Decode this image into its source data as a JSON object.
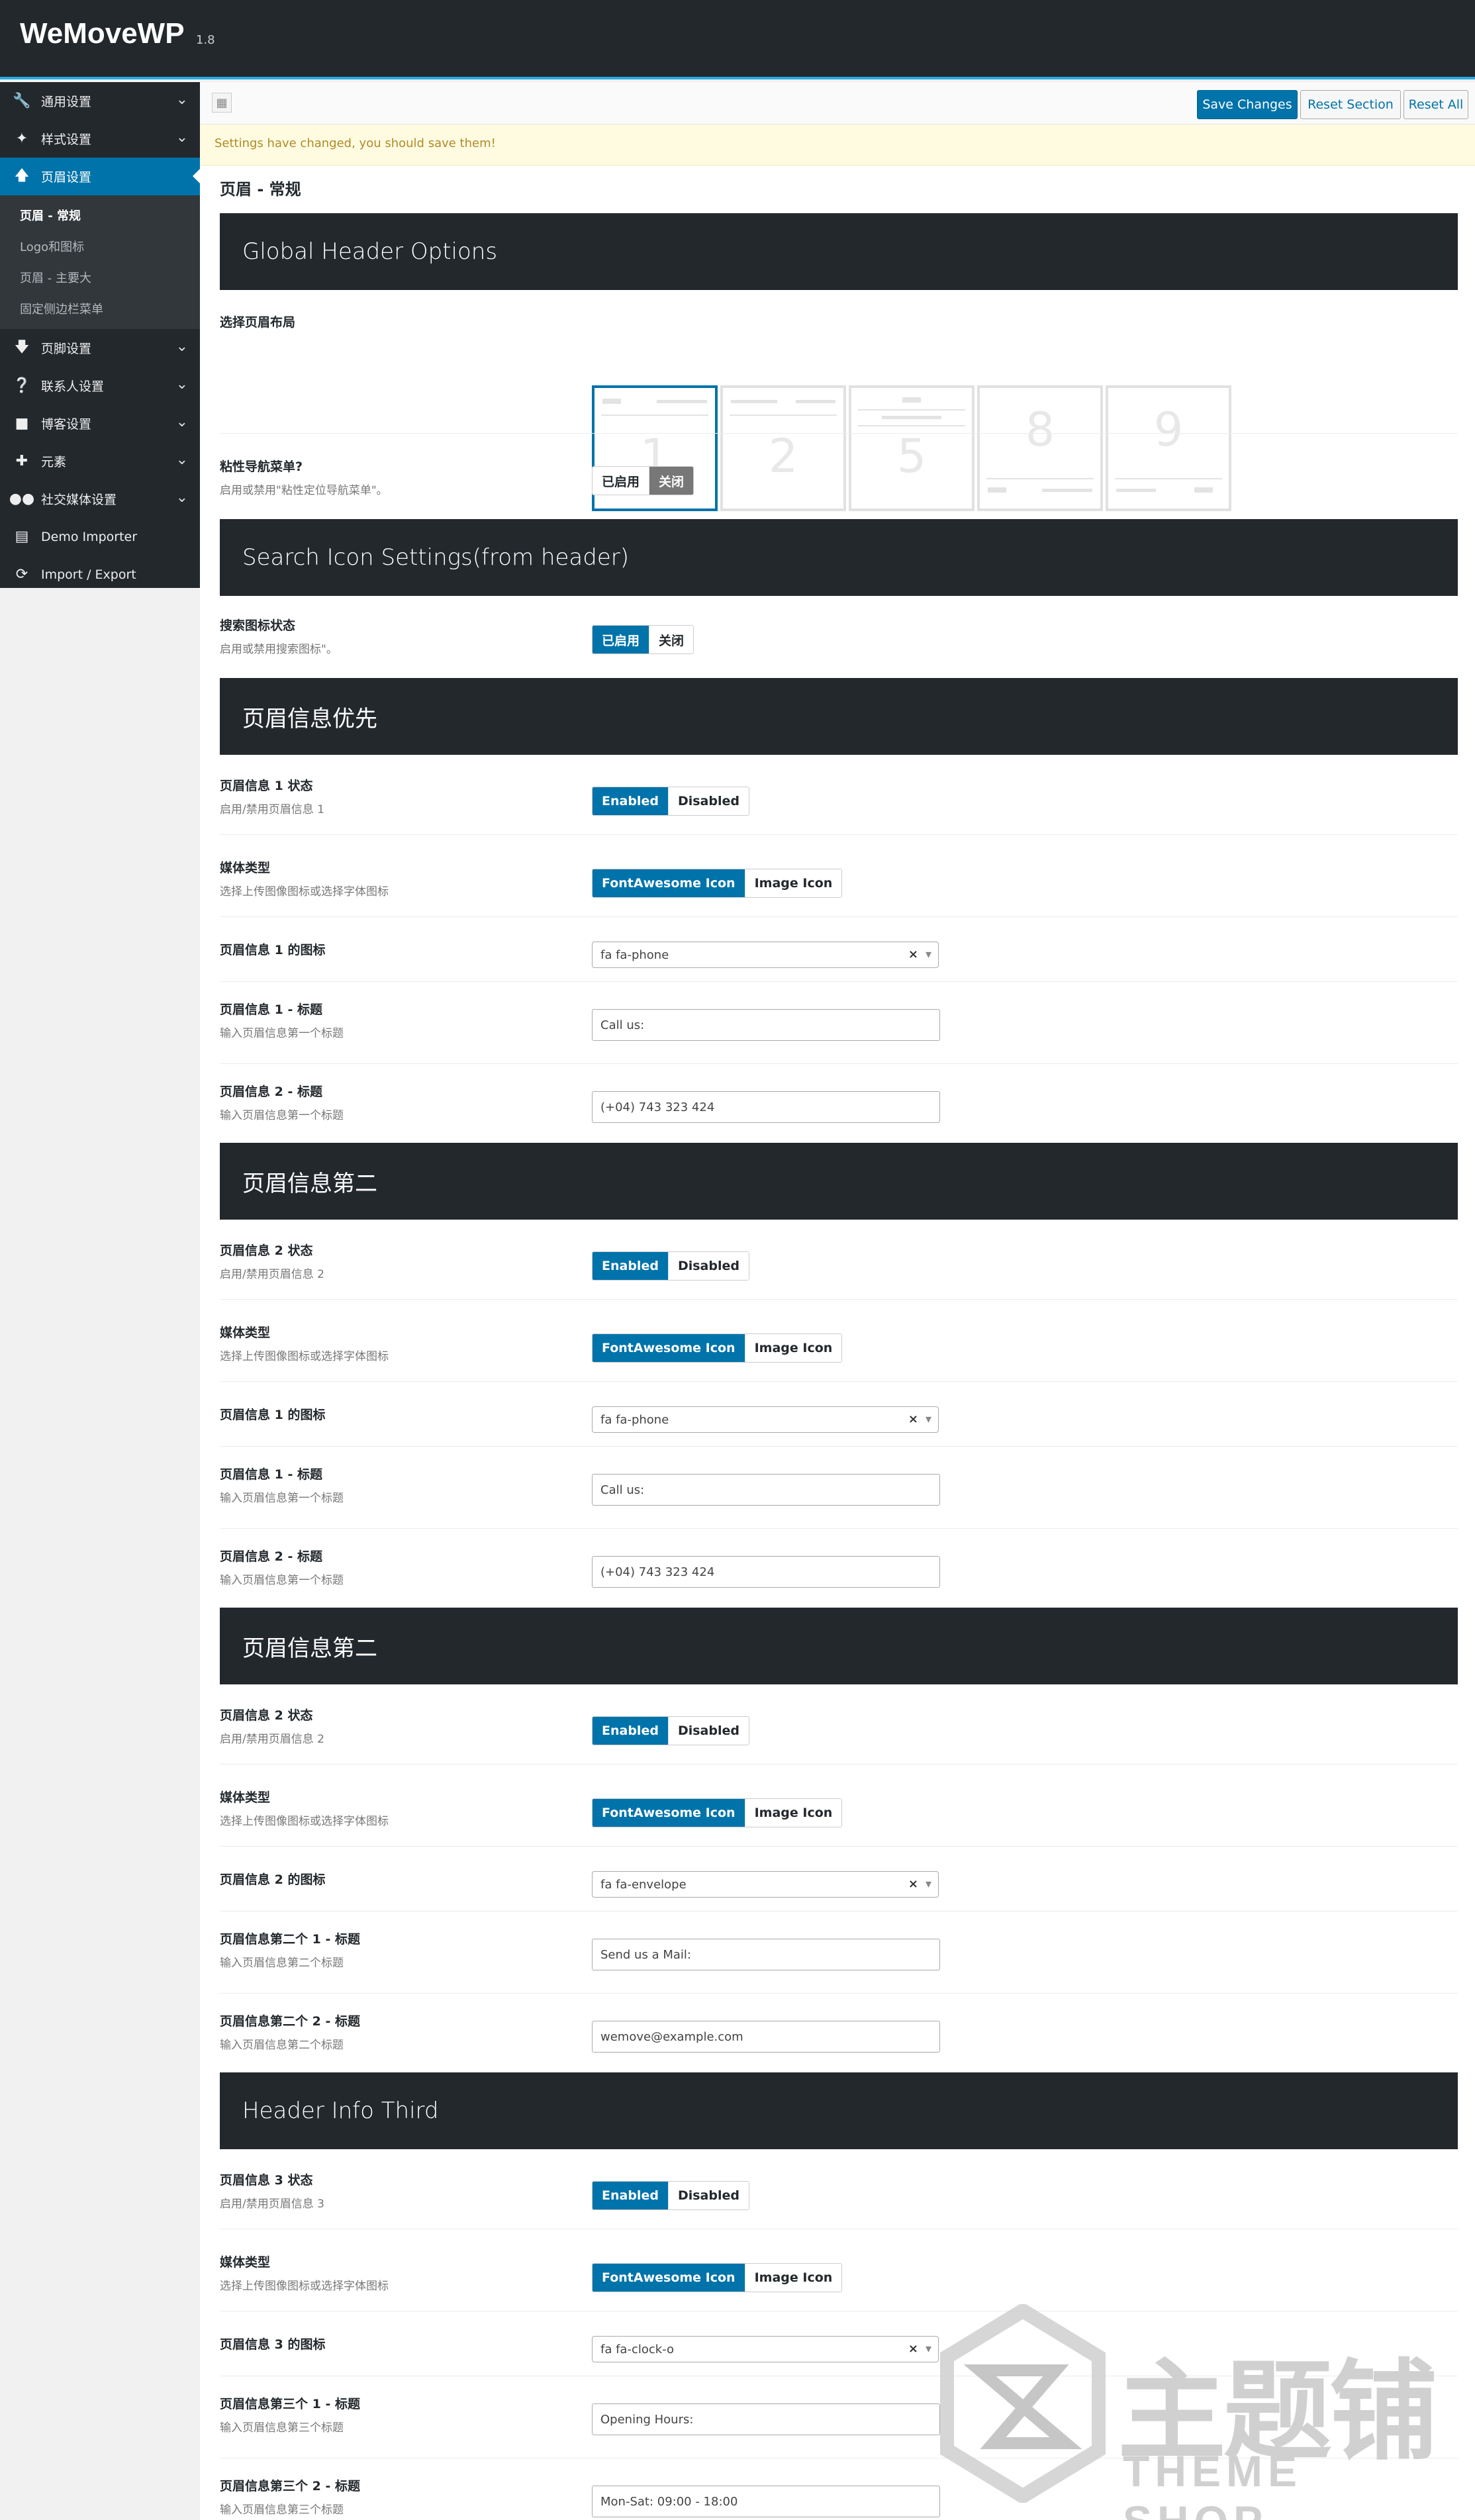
{
  "app": {
    "name": "WeMoveWP",
    "version": "1.8"
  },
  "sidebar": {
    "items": [
      {
        "label": "通用设置",
        "icon": "wrench-icon"
      },
      {
        "label": "样式设置",
        "icon": "magic-wand-icon"
      },
      {
        "label": "页眉设置",
        "icon": "arrow-up-icon",
        "active": true
      },
      {
        "label": "页脚设置",
        "icon": "arrow-down-icon"
      },
      {
        "label": "联系人设置",
        "icon": "question-circle-icon"
      },
      {
        "label": "博客设置",
        "icon": "comment-icon"
      },
      {
        "label": "元素",
        "icon": "puzzle-icon"
      },
      {
        "label": "社交媒体设置",
        "icon": "users-icon"
      },
      {
        "label": "Demo Importer",
        "icon": "list-icon"
      },
      {
        "label": "Import / Export",
        "icon": "refresh-icon"
      }
    ],
    "submenu": [
      "页眉 - 常规",
      "Logo和图标",
      "页眉 - 主要大",
      "固定侧边栏菜单"
    ]
  },
  "toolbar": {
    "save": "Save Changes",
    "reset_section": "Reset Section",
    "reset_all": "Reset All"
  },
  "notice": "Settings have changed, you should save them!",
  "section_title": "页眉 - 常规",
  "headers": {
    "global": "Global Header Options",
    "search": "Search Icon Settings(from header)",
    "info1": "页眉信息优先",
    "info2a": "页眉信息第二",
    "info2b": "页眉信息第二",
    "info3": "Header Info Third"
  },
  "layout": {
    "label": "选择页眉布局",
    "options": [
      "1",
      "2",
      "5",
      "8",
      "9"
    ],
    "selected": "1"
  },
  "sticky": {
    "label": "粘性导航菜单?",
    "desc": "启用或禁用\"粘性定位导航菜单\"。",
    "on": "已启用",
    "off": "关闭",
    "value": "off"
  },
  "search_icon": {
    "label": "搜索图标状态",
    "desc": "启用或禁用搜索图标\"。",
    "on": "已启用",
    "off": "关闭",
    "value": "on"
  },
  "common": {
    "enabled": "Enabled",
    "disabled": "Disabled",
    "fa_icon": "FontAwesome Icon",
    "image_icon": "Image Icon",
    "media_label": "媒体类型",
    "media_desc": "选择上传图像图标或选择字体图标",
    "clear": "×",
    "caret": "▾"
  },
  "info_blocks": [
    {
      "status_label": "页眉信息 1 状态",
      "status_desc": "启用/禁用页眉信息 1",
      "icon_label": "页眉信息 1 的图标",
      "icon_value": "fa fa-phone",
      "t1_label": "页眉信息 1 - 标题",
      "t1_desc": "输入页眉信息第一个标题",
      "t1_value": "Call us:",
      "t2_label": "页眉信息 2 - 标题",
      "t2_desc": "输入页眉信息第一个标题",
      "t2_value": "(+04) 743 323 424"
    },
    {
      "status_label": "页眉信息 2 状态",
      "status_desc": "启用/禁用页眉信息 2",
      "icon_label": "页眉信息 1 的图标",
      "icon_value": "fa fa-phone",
      "t1_label": "页眉信息 1 - 标题",
      "t1_desc": "输入页眉信息第一个标题",
      "t1_value": "Call us:",
      "t2_label": "页眉信息 2 - 标题",
      "t2_desc": "输入页眉信息第一个标题",
      "t2_value": "(+04) 743 323 424"
    },
    {
      "status_label": "页眉信息 2 状态",
      "status_desc": "启用/禁用页眉信息 2",
      "icon_label": "页眉信息 2 的图标",
      "icon_value": "fa fa-envelope",
      "t1_label": "页眉信息第二个 1 - 标题",
      "t1_desc": "输入页眉信息第二个标题",
      "t1_value": "Send us a Mail:",
      "t2_label": "页眉信息第二个 2 - 标题",
      "t2_desc": "输入页眉信息第二个标题",
      "t2_value": "wemove@example.com"
    },
    {
      "status_label": "页眉信息 3 状态",
      "status_desc": "启用/禁用页眉信息 3",
      "icon_label": "页眉信息 3 的图标",
      "icon_value": "fa fa-clock-o",
      "t1_label": "页眉信息第三个 1 - 标题",
      "t1_desc": "输入页眉信息第三个标题",
      "t1_value": "Opening Hours:",
      "t2_label": "页眉信息第三个 2 - 标题",
      "t2_desc": "输入页眉信息第三个标题",
      "t2_value": "Mon-Sat: 09:00 - 18:00"
    }
  ],
  "watermark": {
    "cn": "主题铺",
    "en": "THEME SHOP"
  }
}
